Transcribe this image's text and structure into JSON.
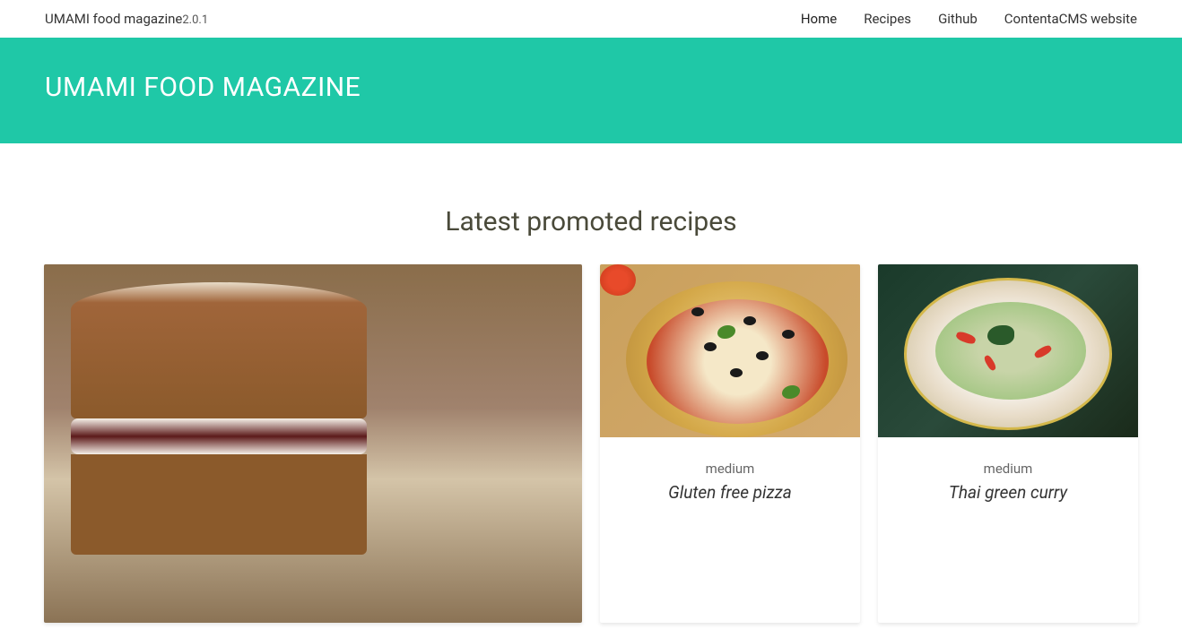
{
  "navbar": {
    "brand_name": "UMAMI food magazine",
    "brand_version": "2.0.1",
    "links": [
      {
        "label": "Home",
        "active": true
      },
      {
        "label": "Recipes",
        "active": false
      },
      {
        "label": "Github",
        "active": false
      },
      {
        "label": "ContentaCMS website",
        "active": false
      }
    ]
  },
  "hero": {
    "title": "UMAMI FOOD MAGAZINE"
  },
  "section": {
    "title": "Latest promoted recipes"
  },
  "recipes": [
    {
      "difficulty": "",
      "title": ""
    },
    {
      "difficulty": "medium",
      "title": "Gluten free pizza"
    },
    {
      "difficulty": "medium",
      "title": "Thai green curry"
    }
  ]
}
